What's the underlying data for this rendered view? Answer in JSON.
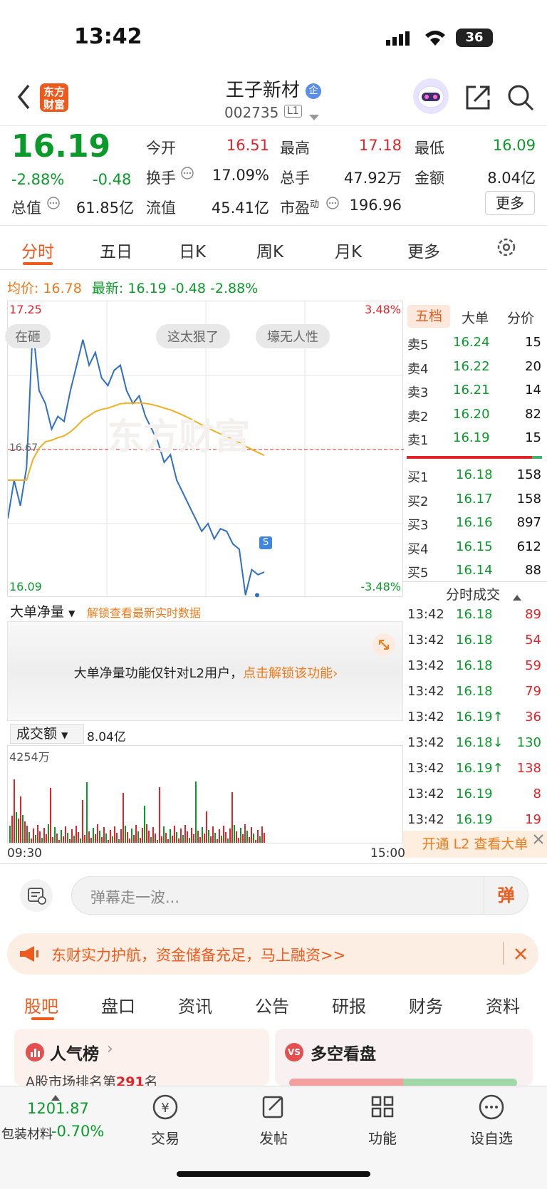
{
  "status": {
    "time": "13:42",
    "battery": "36"
  },
  "header": {
    "logo_line1": "东方",
    "logo_line2": "财富",
    "name": "王子新材",
    "badge": "企",
    "code": "002735",
    "level": "L1"
  },
  "quote": {
    "price": "16.19",
    "change_pct": "-2.88%",
    "change": "-0.48",
    "open_label": "今开",
    "open": "16.51",
    "high_label": "最高",
    "high": "17.18",
    "low_label": "最低",
    "low": "16.09",
    "turnover_label": "换手",
    "turnover": "17.09%",
    "vol_label": "总手",
    "vol": "47.92万",
    "amount_label": "金额",
    "amount": "8.04亿",
    "mktcap_label": "总值",
    "mktcap": "61.85亿",
    "float_label": "流值",
    "float": "45.41亿",
    "pe_label": "市盈",
    "pe_sup": "动",
    "pe": "196.96",
    "more": "更多"
  },
  "tabs": [
    "分时",
    "五日",
    "日K",
    "周K",
    "月K",
    "更多"
  ],
  "chart_info": {
    "avg_label": "均价:",
    "avg": "16.78",
    "last_label": "最新:",
    "last": "16.19",
    "chg": "-0.48",
    "pct": "-2.88%",
    "y_top": "17.25",
    "y_bottom": "16.09",
    "pct_top": "3.48%",
    "pct_bottom": "-3.48%",
    "mid": "16.67",
    "danmu": [
      "在砸",
      "这太狠了",
      "壕无人性"
    ],
    "marker": "S",
    "watermark": "东方财富"
  },
  "chart_data": {
    "type": "line",
    "series": [
      {
        "name": "",
        "values": [
          16.4,
          16.55,
          16.45,
          16.6,
          17.15,
          16.9,
          16.85,
          16.75,
          16.8,
          16.78,
          16.9,
          17.0,
          17.1,
          17.0,
          17.05,
          16.95,
          16.92,
          16.98,
          17.0,
          16.9,
          16.85,
          16.88,
          16.8,
          16.75,
          16.7,
          16.62,
          16.65,
          16.55,
          16.5,
          16.45,
          16.4,
          16.35,
          16.38,
          16.32,
          16.36,
          16.35,
          16.3,
          16.28,
          16.1,
          16.2,
          16.18,
          16.19
        ]
      }
    ]
  },
  "depth_tabs": [
    "五档",
    "大单",
    "分价"
  ],
  "asks": [
    {
      "label": "卖5",
      "price": "16.24",
      "vol": "15"
    },
    {
      "label": "卖4",
      "price": "16.22",
      "vol": "20"
    },
    {
      "label": "卖3",
      "price": "16.21",
      "vol": "14"
    },
    {
      "label": "卖2",
      "price": "16.20",
      "vol": "82"
    },
    {
      "label": "卖1",
      "price": "16.19",
      "vol": "15"
    }
  ],
  "bids": [
    {
      "label": "买1",
      "price": "16.18",
      "vol": "158"
    },
    {
      "label": "买2",
      "price": "16.17",
      "vol": "158"
    },
    {
      "label": "买3",
      "price": "16.16",
      "vol": "897"
    },
    {
      "label": "买4",
      "price": "16.15",
      "vol": "612"
    },
    {
      "label": "买5",
      "price": "16.14",
      "vol": "88"
    }
  ],
  "ticks_title": "分时成交",
  "ticks": [
    {
      "t": "13:42",
      "p": "16.18",
      "v": "89",
      "c": "red"
    },
    {
      "t": "13:42",
      "p": "16.18",
      "v": "54",
      "c": "red"
    },
    {
      "t": "13:42",
      "p": "16.18",
      "v": "59",
      "c": "red"
    },
    {
      "t": "13:42",
      "p": "16.18",
      "v": "79",
      "c": "red"
    },
    {
      "t": "13:42",
      "p": "16.19↑",
      "v": "36",
      "c": "red"
    },
    {
      "t": "13:42",
      "p": "16.18↓",
      "v": "130",
      "c": "green"
    },
    {
      "t": "13:42",
      "p": "16.19↑",
      "v": "138",
      "c": "red"
    },
    {
      "t": "13:42",
      "p": "16.19",
      "v": "8",
      "c": "red"
    },
    {
      "t": "13:42",
      "p": "16.19",
      "v": "19",
      "c": "red"
    }
  ],
  "l2_promo": "开通 L2 查看大单",
  "bigorder": {
    "select": "大单净量",
    "unlock_link": "解锁查看最新实时数据",
    "msg": "大单净量功能仅针对L2用户，",
    "msg_link": "点击解锁该功能"
  },
  "volume": {
    "select": "成交额",
    "value": "8.04亿",
    "max": "4254万",
    "t_start": "09:30",
    "t_end": "15:00"
  },
  "danmu_input": {
    "placeholder": "弹幕走一波...",
    "btn": "弹"
  },
  "banner": {
    "text": "东财实力护航，资金储备充足，马上融资>>"
  },
  "section_tabs": [
    "股吧",
    "盘口",
    "资讯",
    "公告",
    "研报",
    "财务",
    "资料"
  ],
  "cards": {
    "hot": "人气榜",
    "hot_sub": "A股市场排名第",
    "rank": "291",
    "rank_unit": "名",
    "vs": "多空看盘"
  },
  "bottom": {
    "index": "1201.87",
    "index_name": "包装材料",
    "index_pct": "-0.70%",
    "trade": "交易",
    "post": "发帖",
    "func": "功能",
    "watch": "设自选"
  }
}
